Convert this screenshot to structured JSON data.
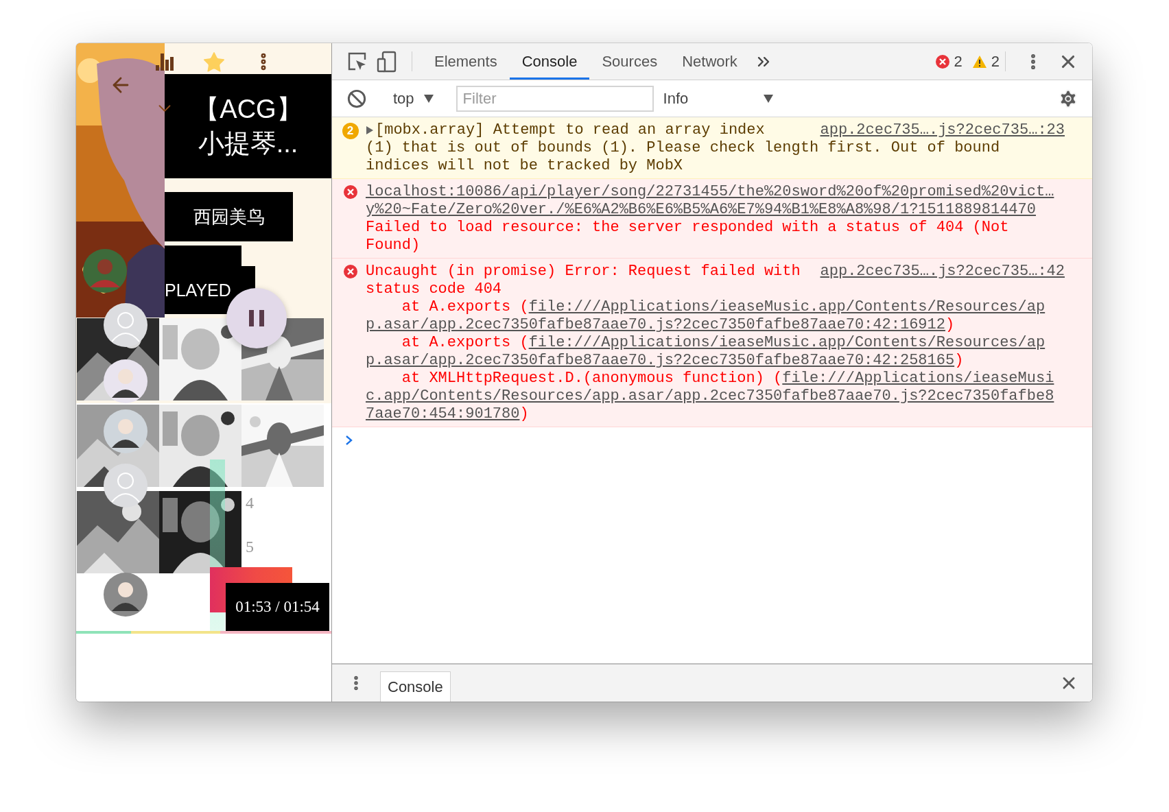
{
  "player": {
    "title_lines": [
      "【ACG】",
      "小提琴..."
    ],
    "artist": "西园美鸟",
    "status": "PLAYED",
    "time": "01:53 / 01:54",
    "favorited": true,
    "playing": true,
    "list_numbers": [
      "4",
      "5"
    ]
  },
  "devtools": {
    "tabs": [
      {
        "label": "Elements",
        "selected": false
      },
      {
        "label": "Console",
        "selected": true
      },
      {
        "label": "Sources",
        "selected": false
      },
      {
        "label": "Network",
        "selected": false
      }
    ],
    "error_count": "2",
    "warning_count": "2",
    "context": "top",
    "filter": {
      "placeholder": "Filter"
    },
    "level": "Info",
    "messages": [
      {
        "kind": "warning",
        "count": "2",
        "expanded": false,
        "source": "app.2cec735….js?2cec735…:23",
        "lines": [
          {
            "segments": [
              {
                "text": "[mobx.array] Attempt to read an array index",
                "kind": "text"
              }
            ]
          },
          {
            "segments": [
              {
                "text": "(1) that is out of bounds (1). Please check length first. Out of bound",
                "kind": "text"
              }
            ]
          },
          {
            "segments": [
              {
                "text": "indices will not be tracked by MobX",
                "kind": "text"
              }
            ]
          }
        ]
      },
      {
        "kind": "error",
        "lines": [
          {
            "segments": [
              {
                "text": "localhost:10086/api/player/song/22731455/the%20sword%20of%20promised%20vict…",
                "kind": "link"
              }
            ]
          },
          {
            "segments": [
              {
                "text": "y%20~Fate/Zero%20ver./%E6%A2%B6%E6%B5%A6%E7%94%B1%E8%A8%98/1?1511889814470",
                "kind": "link"
              }
            ]
          },
          {
            "segments": [
              {
                "text": "Failed to load resource: the server responded with a status of 404 (Not",
                "kind": "text"
              }
            ]
          },
          {
            "segments": [
              {
                "text": "Found)",
                "kind": "text"
              }
            ]
          }
        ]
      },
      {
        "kind": "error",
        "source": "app.2cec735….js?2cec735…:42",
        "lines": [
          {
            "segments": [
              {
                "text": "Uncaught (in promise) Error: Request failed with",
                "kind": "text"
              }
            ]
          },
          {
            "segments": [
              {
                "text": "status code 404",
                "kind": "text"
              }
            ]
          },
          {
            "segments": [
              {
                "text": "    at A.exports (",
                "kind": "text"
              },
              {
                "text": "file:///Applications/ieaseMusic.app/Contents/Resources/ap",
                "kind": "link"
              }
            ]
          },
          {
            "segments": [
              {
                "text": "p.asar/app.2cec7350fafbe87aae70.js?2cec7350fafbe87aae70:42:16912",
                "kind": "link"
              },
              {
                "text": ")",
                "kind": "text"
              }
            ]
          },
          {
            "segments": [
              {
                "text": "    at A.exports (",
                "kind": "text"
              },
              {
                "text": "file:///Applications/ieaseMusic.app/Contents/Resources/ap",
                "kind": "link"
              }
            ]
          },
          {
            "segments": [
              {
                "text": "p.asar/app.2cec7350fafbe87aae70.js?2cec7350fafbe87aae70:42:258165",
                "kind": "link"
              },
              {
                "text": ")",
                "kind": "text"
              }
            ]
          },
          {
            "segments": [
              {
                "text": "    at XMLHttpRequest.D.(anonymous function) (",
                "kind": "text"
              },
              {
                "text": "file:///Applications/ieaseMusi",
                "kind": "link"
              }
            ]
          },
          {
            "segments": [
              {
                "text": "c.app/Contents/Resources/app.asar/app.2cec7350fafbe87aae70.js?2cec7350fafbe8",
                "kind": "link"
              }
            ]
          },
          {
            "segments": [
              {
                "text": "7aae70:454:901780",
                "kind": "link"
              },
              {
                "text": ")",
                "kind": "text"
              }
            ]
          }
        ]
      }
    ],
    "drawer_tabs": [
      {
        "label": "Console",
        "selected": true
      }
    ]
  }
}
